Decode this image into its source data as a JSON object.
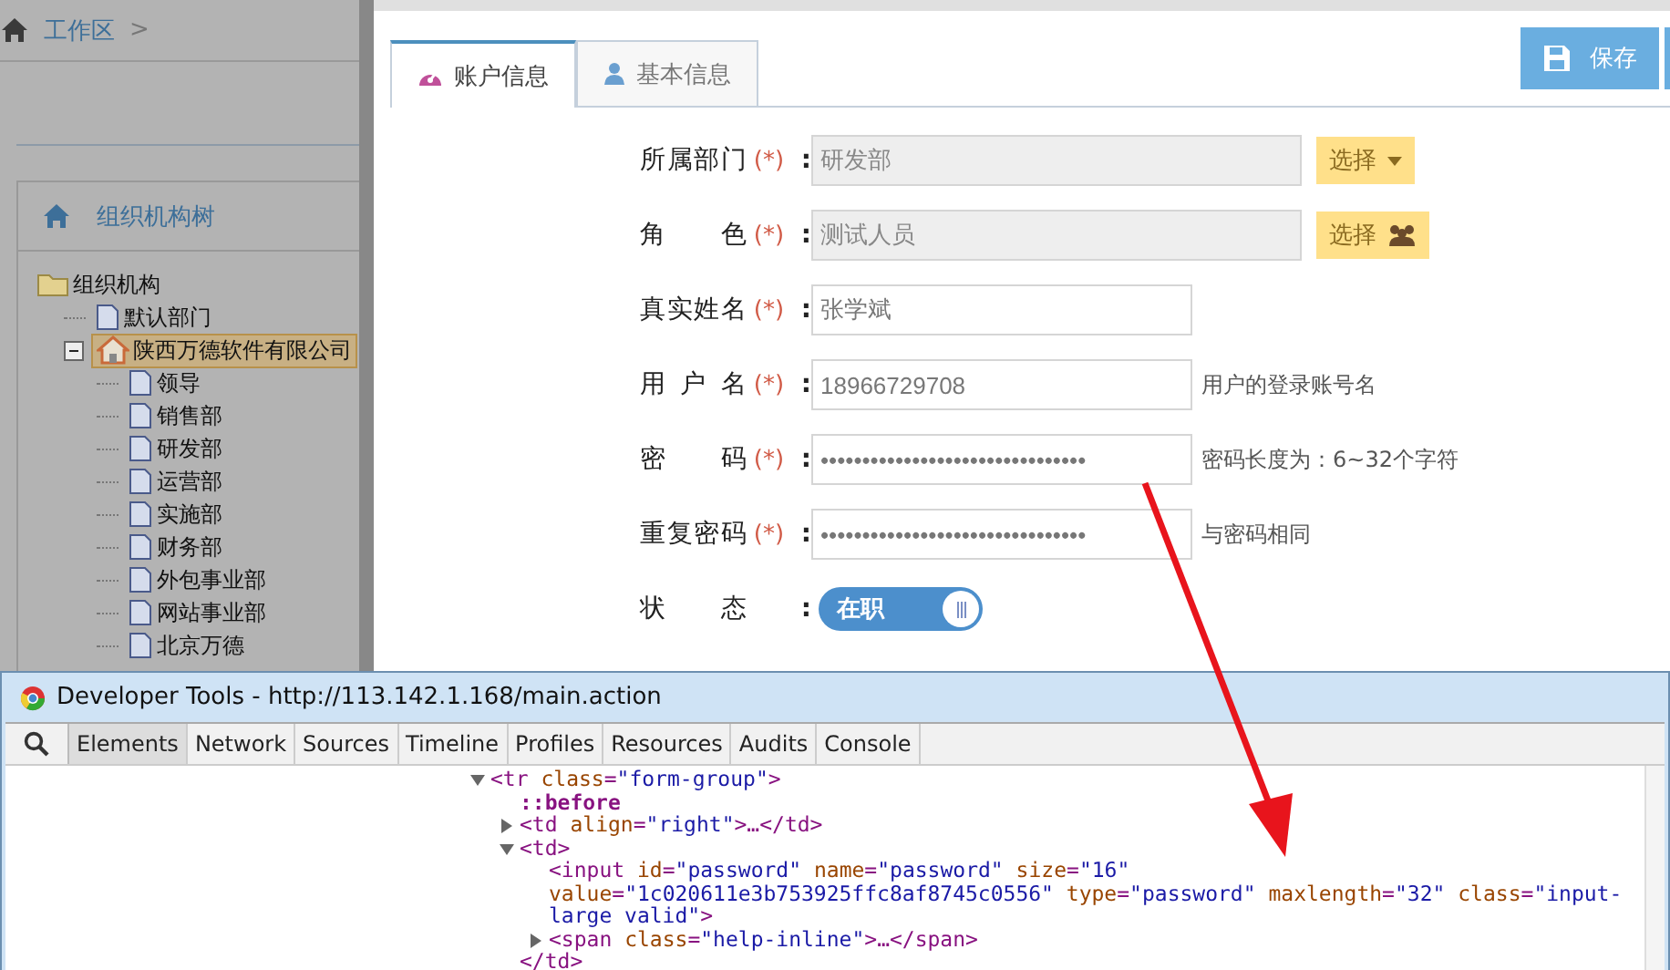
{
  "breadcrumb": {
    "label": "工作区",
    "separator": ">"
  },
  "org_panel": {
    "title": "组织机构树",
    "tree": [
      {
        "label": "组织机构",
        "kind": "folder",
        "selected": false,
        "children": [
          {
            "label": "默认部门",
            "kind": "page",
            "selected": false
          },
          {
            "label": "陕西万德软件有限公司",
            "kind": "company",
            "expanded": true,
            "selected": true,
            "children": [
              {
                "label": "领导",
                "kind": "page",
                "selected": false
              },
              {
                "label": "销售部",
                "kind": "page",
                "selected": false
              },
              {
                "label": "研发部",
                "kind": "page",
                "selected": false
              },
              {
                "label": "运营部",
                "kind": "page",
                "selected": false
              },
              {
                "label": "实施部",
                "kind": "page",
                "selected": false
              },
              {
                "label": "财务部",
                "kind": "page",
                "selected": false
              },
              {
                "label": "外包事业部",
                "kind": "page",
                "selected": false
              },
              {
                "label": "网站事业部",
                "kind": "page",
                "selected": false
              },
              {
                "label": "北京万德",
                "kind": "page",
                "selected": false
              }
            ]
          }
        ]
      }
    ]
  },
  "tabs": [
    {
      "label": "账户信息",
      "selected": true
    },
    {
      "label": "基本信息",
      "selected": false
    }
  ],
  "save_button": {
    "label": "保存"
  },
  "form": [
    {
      "label": "所属部门",
      "required": "(*)",
      "colon": ":",
      "kind": "picker",
      "value": "研发部",
      "disabled": true,
      "button": {
        "label": "选择"
      }
    },
    {
      "label": "角 色",
      "required": "(*)",
      "colon": ":",
      "kind": "picker",
      "value": "测试人员",
      "disabled": true,
      "button": {
        "label": "选择"
      }
    },
    {
      "label": "真实姓名",
      "required": "(*)",
      "colon": ":",
      "kind": "text",
      "value": "张学斌",
      "disabled": false
    },
    {
      "label": "用 户 名",
      "required": "(*)",
      "colon": ":",
      "kind": "text",
      "value": "18966729708",
      "disabled": false,
      "help": "用户的登录账号名"
    },
    {
      "label": "密 码",
      "required": "(*)",
      "colon": ":",
      "kind": "text",
      "value": "••••••••••••••••••••••••••••••••",
      "disabled": false,
      "help": "密码长度为：6~32个字符"
    },
    {
      "label": "重复密码",
      "required": "(*)",
      "colon": ":",
      "kind": "text",
      "value": "••••••••••••••••••••••••••••••••",
      "disabled": false,
      "help": "与密码相同"
    },
    {
      "label": "状 态",
      "colon": ":",
      "kind": "toggle",
      "on": true,
      "value": "在职"
    }
  ],
  "devtools": {
    "title": "Developer Tools - http://113.142.1.168/main.action",
    "tabs": [
      {
        "label": "Elements",
        "selected": true
      },
      {
        "label": "Network",
        "selected": false
      },
      {
        "label": "Sources",
        "selected": false
      },
      {
        "label": "Timeline",
        "selected": false
      },
      {
        "label": "Profiles",
        "selected": false
      },
      {
        "label": "Resources",
        "selected": false
      },
      {
        "label": "Audits",
        "selected": false
      },
      {
        "label": "Console",
        "selected": false
      }
    ],
    "dom_tree": [
      {
        "text": "<tr class=\"form-group\">",
        "expanded": true,
        "children": [
          {
            "text": "::before"
          },
          {
            "text": "<td align=\"right\">…</td>",
            "expanded": false
          },
          {
            "text": "<td>",
            "expanded": true,
            "closing": "</td>",
            "children": [
              {
                "text": "<input id=\"password\" name=\"password\" size=\"16\" value=\"1c020611e3b753925ffc8af8745c0556\" type=\"password\" maxlength=\"32\" class=\"input-large valid\">"
              },
              {
                "text": "<span class=\"help-inline\">…</span>",
                "expanded": false
              }
            ]
          }
        ]
      }
    ]
  }
}
